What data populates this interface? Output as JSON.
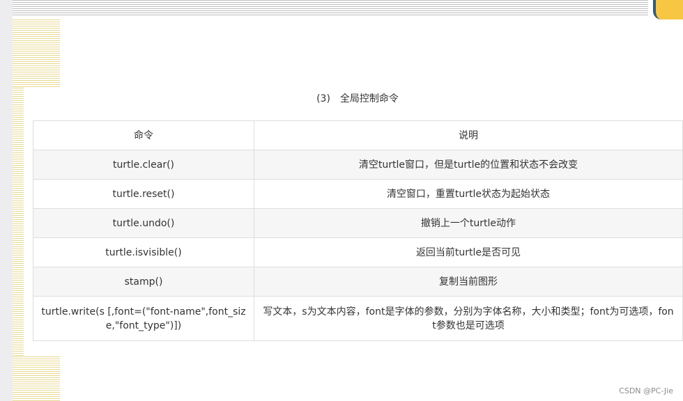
{
  "caption": "(3)　全局控制命令",
  "table": {
    "headers": [
      "命令",
      "说明"
    ],
    "rows": [
      {
        "command": "turtle.clear()",
        "description": "清空turtle窗口，但是turtle的位置和状态不会改变"
      },
      {
        "command": "turtle.reset()",
        "description": "清空窗口，重置turtle状态为起始状态"
      },
      {
        "command": "turtle.undo()",
        "description": "撤销上一个turtle动作"
      },
      {
        "command": "turtle.isvisible()",
        "description": "返回当前turtle是否可见"
      },
      {
        "command": "stamp()",
        "description": "复制当前图形"
      },
      {
        "command": "turtle.write(s [,font=(\"font-name\",font_size,\"font_type\")])",
        "description": "写文本，s为文本内容，font是字体的参数，分别为字体名称，大小和类型；font为可选项，font参数也是可选项"
      }
    ]
  },
  "watermark": "CSDN @PC-Jie"
}
